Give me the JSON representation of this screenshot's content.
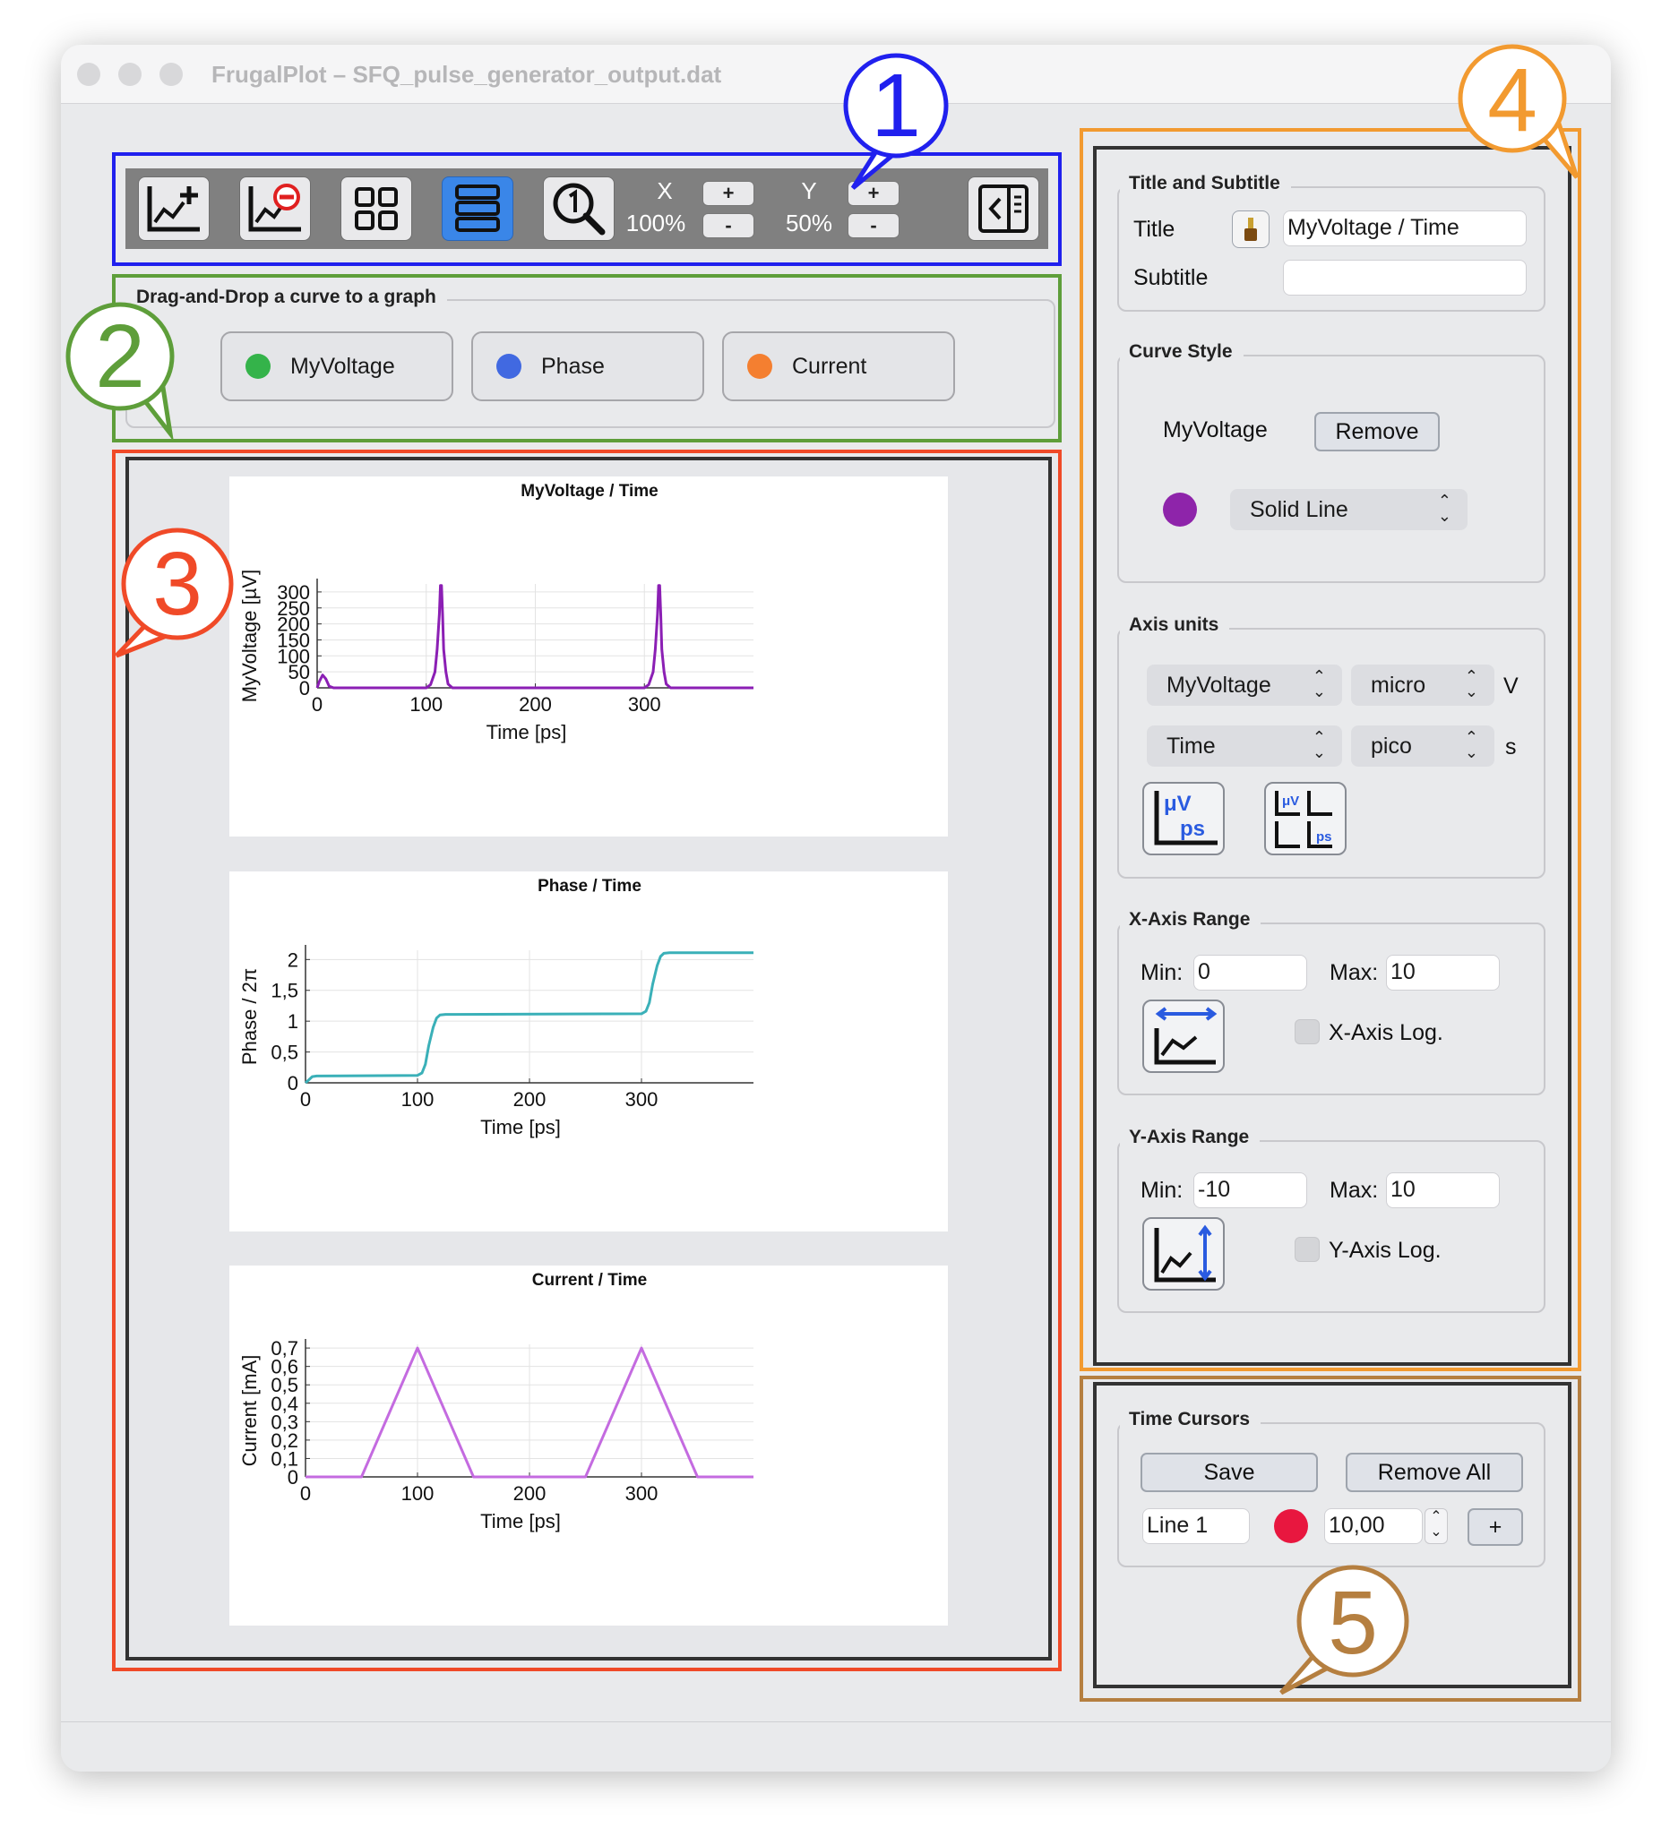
{
  "window": {
    "title": "FrugalPlot – SFQ_pulse_generator_output.dat"
  },
  "toolbar": {
    "x_label": "X",
    "x_zoom": "100%",
    "y_label": "Y",
    "y_zoom": "50%",
    "plus": "+",
    "minus": "-",
    "icons": [
      "add-graph-icon",
      "remove-graph-icon",
      "grid-layout-icon",
      "stacked-layout-icon",
      "zoom-reset-icon",
      "toggle-sidebar-icon"
    ]
  },
  "curves": {
    "group_title": "Drag-and-Drop a curve to a graph",
    "items": [
      {
        "label": "MyVoltage",
        "color": "#34b34a"
      },
      {
        "label": "Phase",
        "color": "#4169e1"
      },
      {
        "label": "Current",
        "color": "#f47f30"
      }
    ]
  },
  "chart_data": [
    {
      "type": "line",
      "title": "MyVoltage / Time",
      "xlabel": "Time [ps]",
      "ylabel": "MyVoltage [µV]",
      "xlim": [
        0,
        400
      ],
      "ylim": [
        0,
        325
      ],
      "xticks": [
        "0",
        "100",
        "200",
        "300"
      ],
      "yticks": [
        "0",
        "50",
        "100",
        "150",
        "200",
        "250",
        "300"
      ],
      "grid": true,
      "series": [
        {
          "color": "#8b1fb4",
          "x": [
            0,
            2,
            5,
            8,
            11,
            15,
            100,
            104,
            108,
            110,
            112,
            113,
            114,
            115,
            116,
            118,
            120,
            124,
            300,
            304,
            308,
            310,
            312,
            313,
            314,
            315,
            316,
            318,
            320,
            324,
            400
          ],
          "y": [
            0,
            20,
            40,
            28,
            5,
            0,
            0,
            10,
            50,
            120,
            230,
            320,
            320,
            230,
            120,
            50,
            12,
            0,
            0,
            10,
            50,
            120,
            230,
            320,
            320,
            230,
            120,
            50,
            12,
            0,
            0
          ]
        }
      ]
    },
    {
      "type": "line",
      "title": "Phase / Time",
      "xlabel": "Time [ps]",
      "ylabel": "Phase / 2π",
      "xlim": [
        0,
        400
      ],
      "ylim": [
        0,
        2.15
      ],
      "xticks": [
        "0",
        "100",
        "200",
        "300"
      ],
      "yticks": [
        "0",
        "0,5",
        "1",
        "1,5",
        "2"
      ],
      "grid": true,
      "series": [
        {
          "color": "#3ab0b8",
          "x": [
            0,
            3,
            6,
            10,
            100,
            104,
            107,
            110,
            114,
            117,
            120,
            125,
            300,
            304,
            307,
            310,
            314,
            317,
            320,
            325,
            400
          ],
          "y": [
            0,
            0.05,
            0.1,
            0.11,
            0.12,
            0.16,
            0.3,
            0.6,
            0.9,
            1.05,
            1.1,
            1.11,
            1.12,
            1.16,
            1.3,
            1.6,
            1.9,
            2.05,
            2.1,
            2.11,
            2.11
          ]
        }
      ]
    },
    {
      "type": "line",
      "title": "Current / Time",
      "xlabel": "Time [ps]",
      "ylabel": "Current [mA]",
      "xlim": [
        0,
        400
      ],
      "ylim": [
        0,
        0.72
      ],
      "xticks": [
        "0",
        "100",
        "200",
        "300"
      ],
      "yticks": [
        "0",
        "0,1",
        "0,2",
        "0,3",
        "0,4",
        "0,5",
        "0,6",
        "0,7"
      ],
      "grid": true,
      "series": [
        {
          "color": "#c46be0",
          "x": [
            0,
            50,
            100,
            150,
            250,
            300,
            350,
            400
          ],
          "y": [
            0,
            0,
            0.7,
            0,
            0,
            0.7,
            0,
            0
          ]
        }
      ]
    }
  ],
  "sidebar": {
    "title_group": {
      "header": "Title and Subtitle",
      "title_label": "Title",
      "title_value": "MyVoltage / Time",
      "subtitle_label": "Subtitle",
      "subtitle_value": ""
    },
    "curve_style": {
      "header": "Curve Style",
      "curve_name": "MyVoltage",
      "remove_label": "Remove",
      "color": "#8e24aa",
      "line_style": "Solid Line"
    },
    "axis_units": {
      "header": "Axis units",
      "y_quantity": "MyVoltage",
      "y_prefix": "micro",
      "y_unit": "V",
      "x_quantity": "Time",
      "x_prefix": "pico",
      "x_unit": "s",
      "uv": "μV",
      "ps": "ps"
    },
    "x_range": {
      "header": "X-Axis Range",
      "min_label": "Min:",
      "min_value": "0",
      "max_label": "Max:",
      "max_value": "10",
      "log_label": "X-Axis Log."
    },
    "y_range": {
      "header": "Y-Axis Range",
      "min_label": "Min:",
      "min_value": "-10",
      "max_label": "Max:",
      "max_value": "10",
      "log_label": "Y-Axis Log."
    },
    "cursors": {
      "header": "Time Cursors",
      "save_label": "Save",
      "remove_all_label": "Remove All",
      "line_name": "Line 1",
      "line_color": "#e8173f",
      "line_value": "10,00",
      "add_label": "+"
    }
  },
  "callouts": [
    "1",
    "2",
    "3",
    "4",
    "5"
  ]
}
